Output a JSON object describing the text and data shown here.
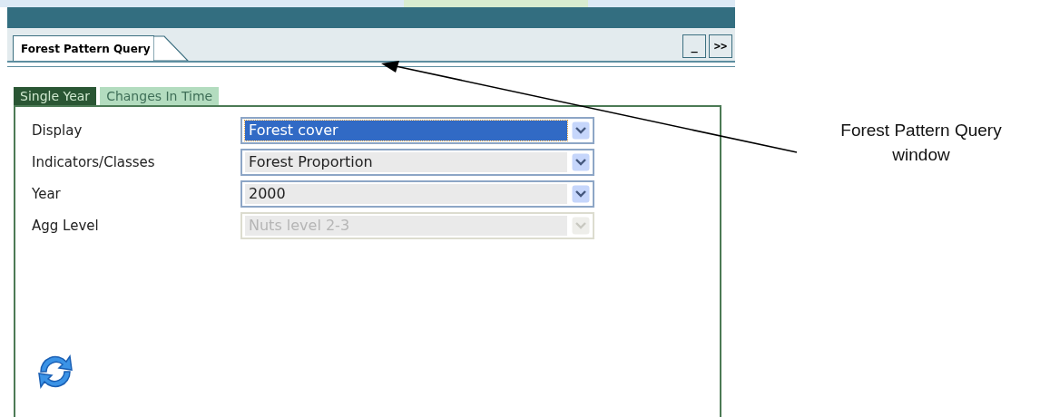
{
  "window": {
    "tab_title": "Forest Pattern Query",
    "buttons": [
      "_",
      ">>"
    ]
  },
  "tabs": [
    {
      "label": "Single Year",
      "selected": true
    },
    {
      "label": "Changes In Time",
      "selected": false
    }
  ],
  "fields": [
    {
      "label": "Display",
      "value": "Forest cover",
      "highlighted": true,
      "disabled": false
    },
    {
      "label": "Indicators/Classes",
      "value": "Forest Proportion",
      "highlighted": false,
      "disabled": false
    },
    {
      "label": "Year",
      "value": "2000",
      "highlighted": false,
      "disabled": false
    },
    {
      "label": "Agg Level",
      "value": "Nuts level 2-3",
      "highlighted": false,
      "disabled": true
    }
  ],
  "annotation": {
    "text": "Forest Pattern Query window"
  }
}
